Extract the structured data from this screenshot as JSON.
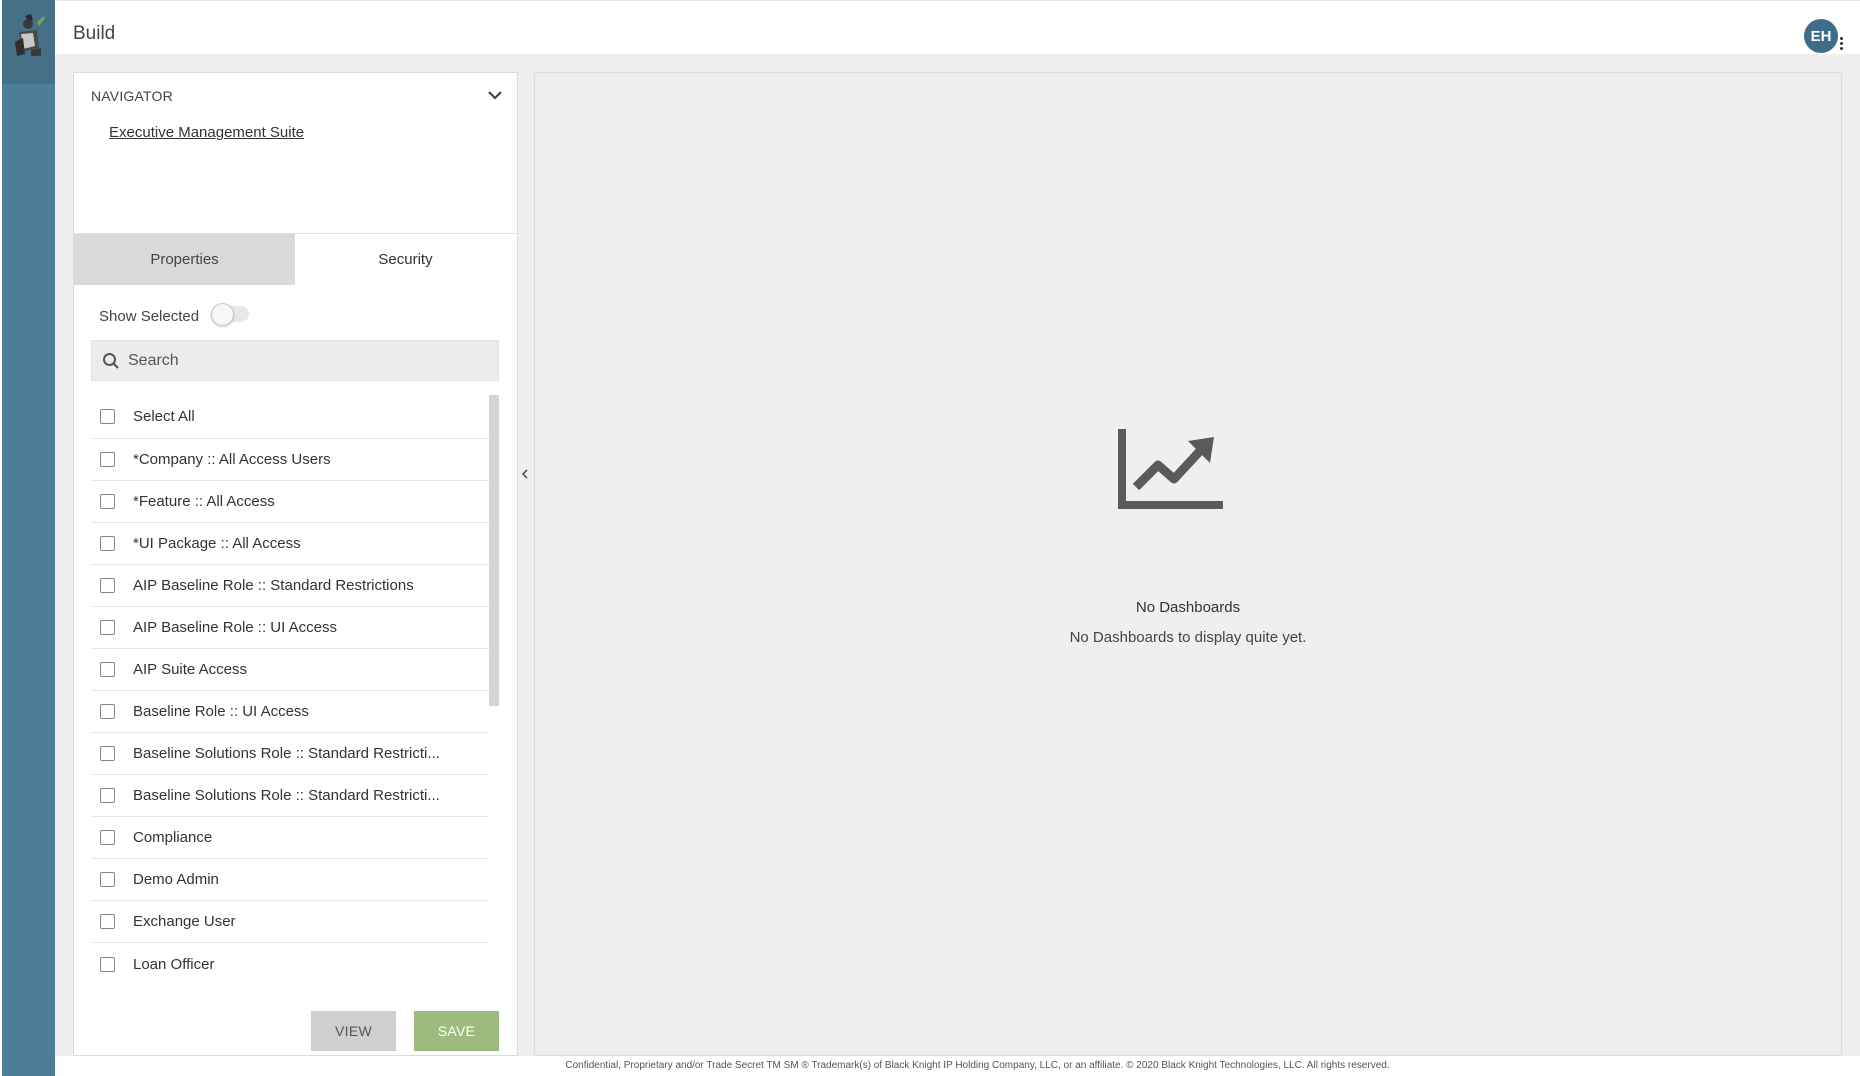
{
  "header": {
    "title": "Build",
    "avatar_initials": "EH"
  },
  "navigator": {
    "heading": "NAVIGATOR",
    "link": "Executive Management Suite"
  },
  "tabs": [
    {
      "label": "Properties",
      "active": false
    },
    {
      "label": "Security",
      "active": true
    }
  ],
  "show_selected": {
    "label": "Show Selected",
    "checked": false
  },
  "search": {
    "placeholder": "Search",
    "value": ""
  },
  "roles": [
    {
      "label": "Select All",
      "checked": false
    },
    {
      "label": "*Company :: All Access Users",
      "checked": false
    },
    {
      "label": "*Feature :: All Access",
      "checked": false
    },
    {
      "label": "*UI Package :: All Access",
      "checked": false
    },
    {
      "label": "AIP Baseline Role :: Standard Restrictions",
      "checked": false
    },
    {
      "label": "AIP Baseline Role :: UI Access",
      "checked": false
    },
    {
      "label": "AIP Suite Access",
      "checked": false
    },
    {
      "label": "Baseline Role :: UI Access",
      "checked": false
    },
    {
      "label": "Baseline Solutions Role :: Standard Restricti...",
      "checked": false
    },
    {
      "label": "Baseline Solutions Role :: Standard Restricti...",
      "checked": false
    },
    {
      "label": "Compliance",
      "checked": false
    },
    {
      "label": "Demo Admin",
      "checked": false
    },
    {
      "label": "Exchange User",
      "checked": false
    },
    {
      "label": "Loan Officer",
      "checked": false
    }
  ],
  "buttons": {
    "view": "VIEW",
    "save": "SAVE"
  },
  "empty_state": {
    "title": "No Dashboards",
    "subtitle": "No Dashboards to display quite yet."
  },
  "footer": {
    "text": "Confidential, Proprietary and/or Trade Secret TM SM ® Trademark(s) of Black Knight IP Holding Company, LLC, or an affiliate. © 2020 Black Knight Technologies, LLC. All rights reserved."
  },
  "colors": {
    "rail": "#4d7e99",
    "avatar": "#3f6d89",
    "save_button": "#9dbb7e",
    "view_button": "#cfcfcf"
  }
}
